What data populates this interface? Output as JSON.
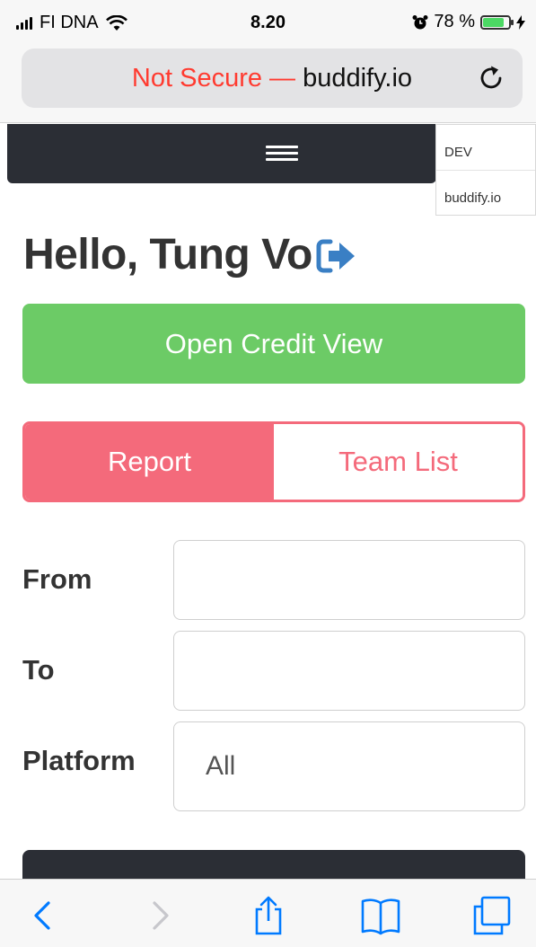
{
  "status_bar": {
    "carrier": "FI DNA",
    "time": "8.20",
    "battery_percent": "78 %",
    "battery_level": 0.78
  },
  "address_bar": {
    "security_text": "Not Secure —",
    "host": "buddify.io",
    "reload_icon": "reload-icon"
  },
  "navbar": {
    "menu_icon": "hamburger-icon",
    "env_label": "DEV",
    "env_host": "buddify.io"
  },
  "greeting": {
    "text": "Hello, Tung Vo",
    "logout_icon": "sign-out-icon"
  },
  "credit_button": {
    "label": "Open Credit View"
  },
  "tabs": [
    {
      "label": "Report",
      "active": true
    },
    {
      "label": "Team List",
      "active": false
    }
  ],
  "form": {
    "from_label": "From",
    "from_value": "",
    "to_label": "To",
    "to_value": "",
    "platform_label": "Platform",
    "platform_value": "All"
  },
  "toolbar": {
    "icons": [
      "back-icon",
      "forward-icon",
      "share-icon",
      "bookmarks-icon",
      "tabs-icon"
    ]
  },
  "colors": {
    "success": "#6ccb66",
    "accent": "#f46a7b",
    "navbar": "#2b2e35",
    "insecure": "#ff3b30",
    "ios_blue": "#007aff",
    "logout_icon": "#3a7fc4"
  }
}
